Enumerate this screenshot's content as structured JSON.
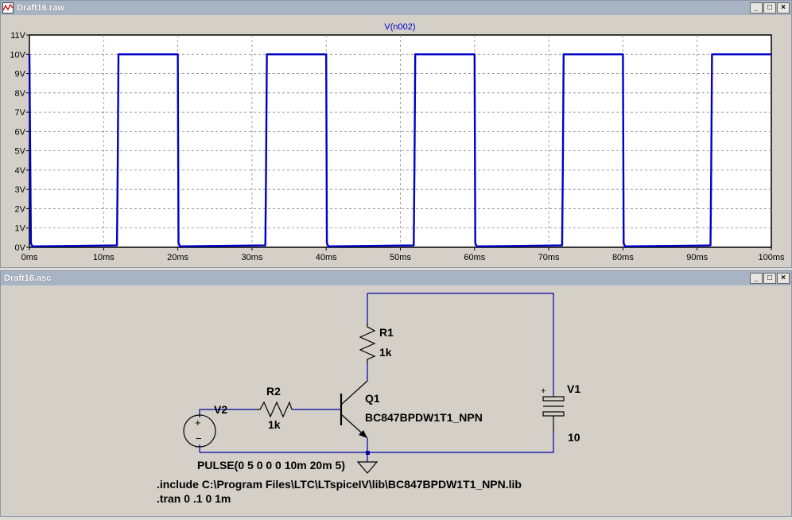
{
  "plot_window": {
    "title": "Draft16.raw",
    "trace_label": "V(n002)"
  },
  "schematic_window": {
    "title": "Draft16.asc"
  },
  "window_buttons": {
    "minimize": "_",
    "restore": "□",
    "close": "×"
  },
  "chart_data": {
    "type": "line",
    "title": "V(n002)",
    "xlabel": "",
    "ylabel": "",
    "xlim": [
      0,
      100
    ],
    "ylim": [
      0,
      11
    ],
    "x_ticks": [
      "0ms",
      "10ms",
      "20ms",
      "30ms",
      "40ms",
      "50ms",
      "60ms",
      "70ms",
      "80ms",
      "90ms",
      "100ms"
    ],
    "y_ticks": [
      "0V",
      "1V",
      "2V",
      "3V",
      "4V",
      "5V",
      "6V",
      "7V",
      "8V",
      "9V",
      "10V",
      "11V"
    ],
    "grid": true,
    "series": [
      {
        "name": "V(n002)",
        "color": "#0000c8",
        "x": [
          0,
          0.2,
          0.4,
          11.8,
          11.9,
          12.0,
          20.0,
          20.1,
          20.3,
          31.8,
          31.9,
          32.0,
          40.0,
          40.1,
          40.3,
          51.8,
          51.9,
          52.0,
          60.0,
          60.1,
          60.3,
          71.8,
          71.9,
          72.0,
          80.0,
          80.1,
          80.3,
          91.8,
          91.9,
          92.0,
          100
        ],
        "y": [
          10,
          0.2,
          0.05,
          0.1,
          4.0,
          10.0,
          10.0,
          0.2,
          0.05,
          0.1,
          4.0,
          10.0,
          10.0,
          0.2,
          0.05,
          0.1,
          4.0,
          10.0,
          10.0,
          0.2,
          0.05,
          0.1,
          4.0,
          10.0,
          10.0,
          0.2,
          0.05,
          0.1,
          4.0,
          10.0,
          10.0
        ]
      }
    ]
  },
  "schematic": {
    "r1_name": "R1",
    "r1_value": "1k",
    "r2_name": "R2",
    "r2_value": "1k",
    "q1_name": "Q1",
    "q1_model": "BC847BPDW1T1_NPN",
    "v1_name": "V1",
    "v1_value": "10",
    "v1_plus": "+",
    "v2_name": "V2",
    "v2_plus": "+",
    "v2_minus": "−",
    "v2_value": "PULSE(0 5 0 0 0 10m 20m 5)",
    "directive_include": ".include C:\\Program Files\\LTC\\LTspiceIV\\lib\\BC847BPDW1T1_NPN.lib",
    "directive_tran": ".tran 0 .1 0 1m"
  }
}
